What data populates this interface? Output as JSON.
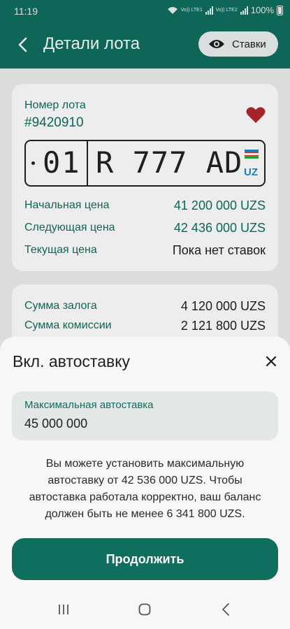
{
  "status_bar": {
    "time": "11:19",
    "battery": "100%",
    "volte1": "Vo)) LTE1",
    "volte2": "Vo)) LTE2"
  },
  "app_bar": {
    "title": "Детали лота",
    "bids_label": "Ставки"
  },
  "lot": {
    "number_label": "Номер лота",
    "number": "#9420910",
    "plate": {
      "region": "01",
      "number": "R 777 AD",
      "country": "UZ"
    },
    "prices": [
      {
        "label": "Начальная цена",
        "value": "41 200 000 UZS"
      },
      {
        "label": "Следующая цена",
        "value": "42 436 000 UZS"
      },
      {
        "label": "Текущая цена",
        "value": "Пока нет ставок"
      }
    ]
  },
  "fees": [
    {
      "label": "Сумма залога",
      "value": "4 120 000 UZS"
    },
    {
      "label": "Сумма комиссии",
      "value": "2 121 800 UZS"
    }
  ],
  "sheet": {
    "title": "Вкл. автоставку",
    "field_label": "Максимальная автоставка",
    "field_value": "45 000 000",
    "note": "Вы можете установить максимальную автоставку от 42 536 000 UZS. Чтобы автоставка работала корректно, ваш баланс должен быть не менее 6 341 800 UZS.",
    "continue_label": "Продолжить"
  },
  "colors": {
    "primary": "#0f6e5e",
    "heart": "#b3262d",
    "flag_blue": "#1e88c6",
    "flag_green": "#1eb53a"
  },
  "icons": [
    "back-icon",
    "eye-icon",
    "heart-icon",
    "close-icon",
    "recents-icon",
    "home-icon",
    "nav-back-icon"
  ]
}
